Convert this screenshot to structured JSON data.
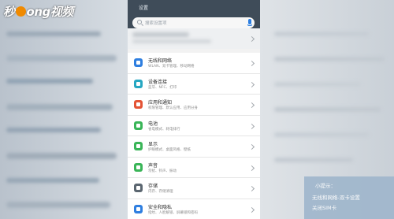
{
  "watermark": {
    "text_left": "秒",
    "text_mid": "ong",
    "text_right": "视频"
  },
  "header": {
    "title": "设置"
  },
  "search": {
    "placeholder": "搜索设置项"
  },
  "menu": [
    {
      "title": "无线和网络",
      "subtitle": "WLAN、双卡管理、移动网络",
      "color": "#2f7fe0"
    },
    {
      "title": "设备连接",
      "subtitle": "蓝牙、NFC、打印",
      "color": "#27a7c2"
    },
    {
      "title": "应用和通知",
      "subtitle": "权限管理、默认应用、应用分身",
      "color": "#e45436"
    },
    {
      "title": "电池",
      "subtitle": "省电模式、耗电排行",
      "color": "#3ab558"
    },
    {
      "title": "显示",
      "subtitle": "护眼模式、桌面风格、壁纸",
      "color": "#3ab558"
    },
    {
      "title": "声音",
      "subtitle": "勿扰、铃声、振动",
      "color": "#3ab558"
    },
    {
      "title": "存储",
      "subtitle": "内存、存储清理",
      "color": "#5b6670"
    },
    {
      "title": "安全和隐私",
      "subtitle": "指纹、人脸解锁、屏幕锁和密码",
      "color": "#2f7fe0"
    }
  ],
  "tip": {
    "title": "小提示：",
    "line1": "无线和网络-双卡设置",
    "line2": "关闭SIM卡"
  }
}
